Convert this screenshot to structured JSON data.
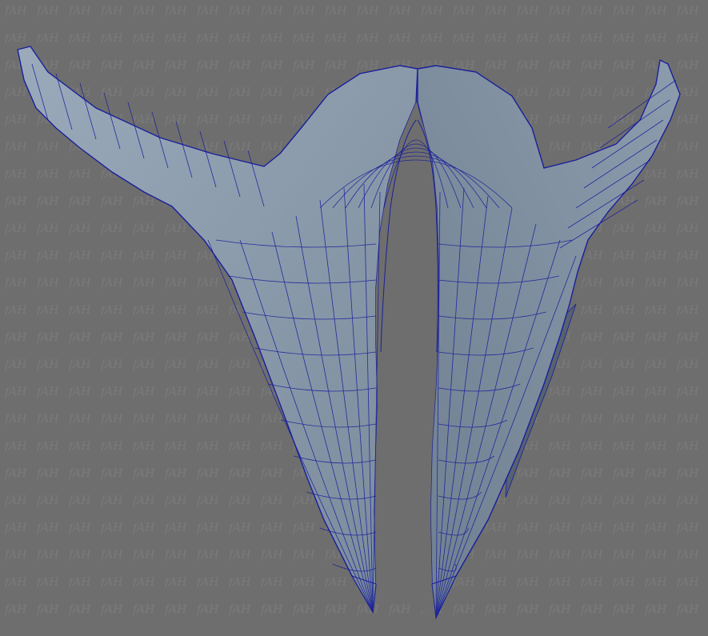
{
  "viewport": {
    "background_color": "#6e6e6e",
    "watermark_text": "fAH",
    "watermark_color": "#7b7b7b"
  },
  "model": {
    "surface_color": "#8596a7",
    "surface_light": "#a3b2c0",
    "surface_dark": "#5d6a78",
    "wireframe_color": "#1a1f9a",
    "parts": [
      "left-horn",
      "right-horn",
      "center-arch",
      "left-fang",
      "right-fang",
      "left-back-fin",
      "right-back-fin"
    ]
  }
}
